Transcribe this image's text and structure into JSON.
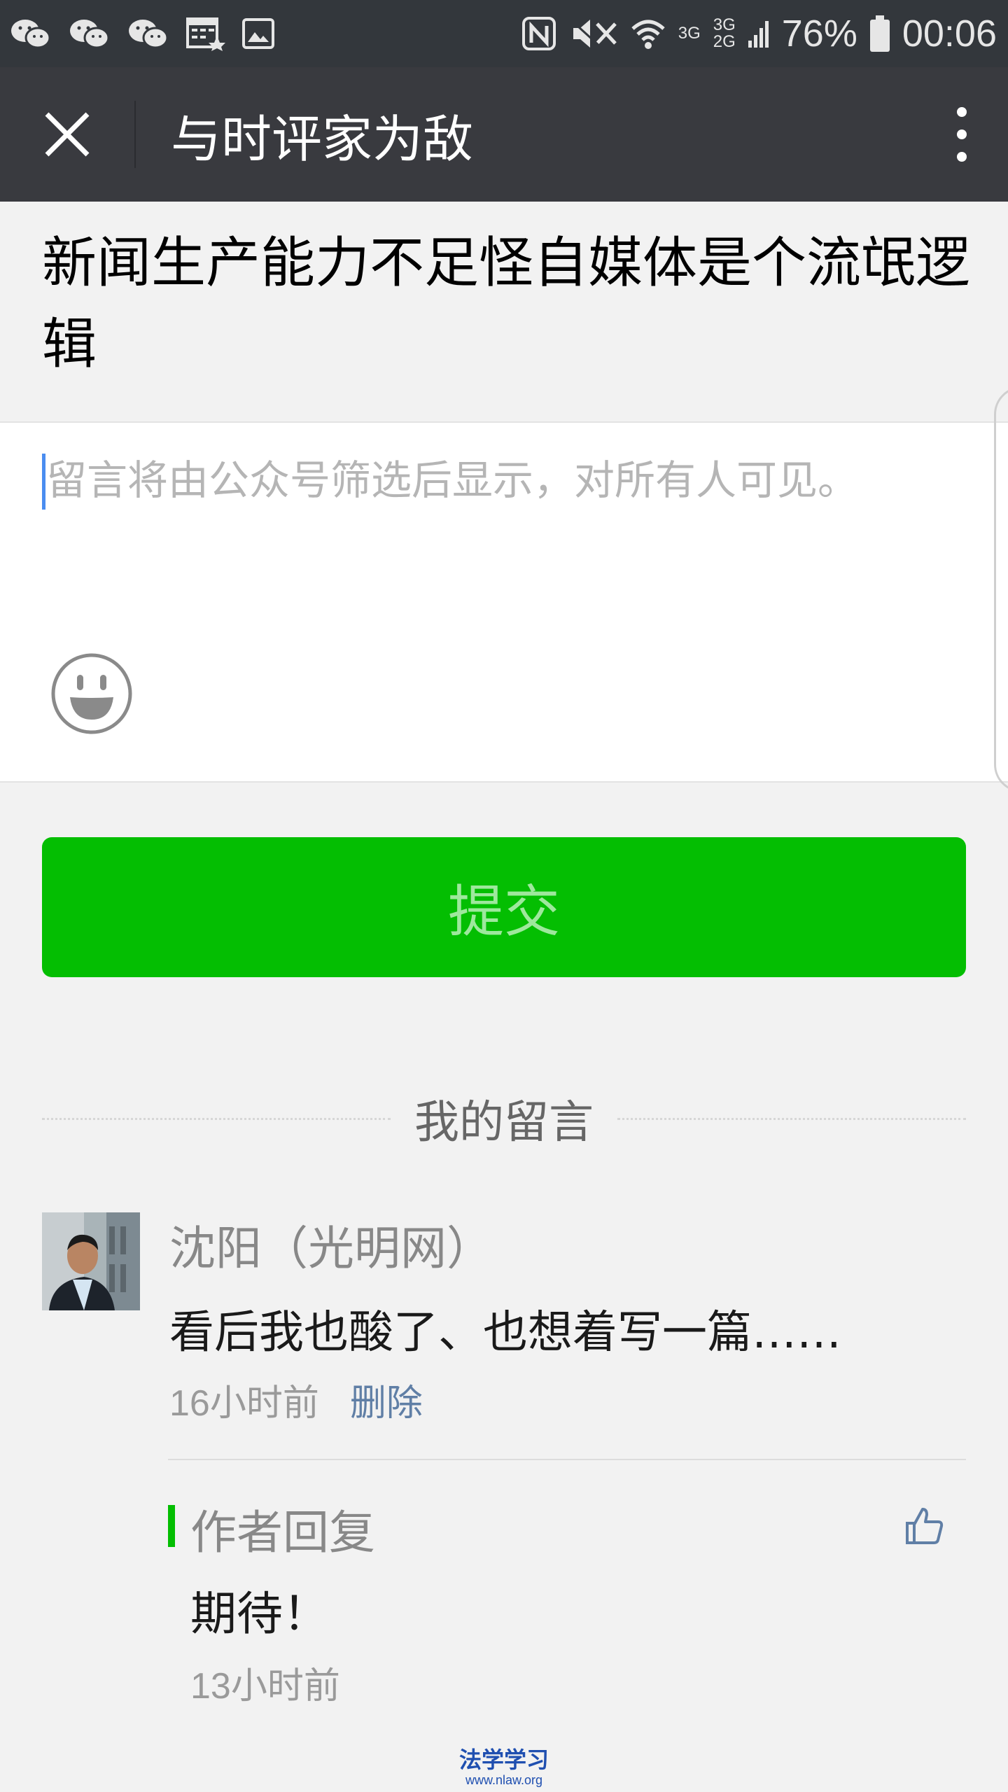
{
  "status_bar": {
    "battery": "76%",
    "time": "00:06",
    "network_top": "3G",
    "network_mid": "3G",
    "network_bottom": "2G",
    "icons": [
      "wechat-icon",
      "wechat-icon",
      "wechat-icon",
      "calendar-icon",
      "image-icon",
      "nfc-icon",
      "mute-icon",
      "wifi-icon",
      "signal-icon",
      "battery-icon"
    ]
  },
  "header": {
    "title": "与时评家为敌",
    "close_icon": "close-icon",
    "more_icon": "more-vertical-icon"
  },
  "article": {
    "title": "新闻生产能力不足怪自媒体是个流氓逻辑"
  },
  "comment_box": {
    "placeholder": "留言将由公众号筛选后显示，对所有人可见。",
    "value": "",
    "emoji_icon": "emoji-icon"
  },
  "submit": {
    "label": "提交",
    "color": "#04be02"
  },
  "my_comments": {
    "label": "我的留言",
    "items": [
      {
        "nickname": "沈阳（光明网）",
        "content": "看后我也酸了、也想着写一篇……",
        "time": "16小时前",
        "delete_label": "删除",
        "reply": {
          "label": "作者回复",
          "content": "期待！",
          "time": "13小时前",
          "like_icon": "thumbs-up-icon"
        }
      }
    ]
  },
  "watermark": {
    "text": "法学学习",
    "url": "www.nlaw.org"
  }
}
